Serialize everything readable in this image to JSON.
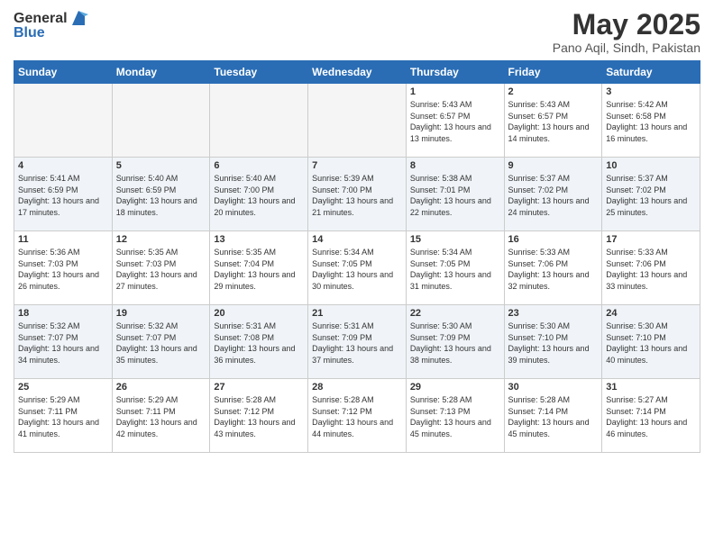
{
  "logo": {
    "general": "General",
    "blue": "Blue"
  },
  "header": {
    "title": "May 2025",
    "subtitle": "Pano Aqil, Sindh, Pakistan"
  },
  "weekdays": [
    "Sunday",
    "Monday",
    "Tuesday",
    "Wednesday",
    "Thursday",
    "Friday",
    "Saturday"
  ],
  "weeks": [
    [
      {
        "day": "",
        "info": ""
      },
      {
        "day": "",
        "info": ""
      },
      {
        "day": "",
        "info": ""
      },
      {
        "day": "",
        "info": ""
      },
      {
        "day": "1",
        "sunrise": "5:43 AM",
        "sunset": "6:57 PM",
        "daylight": "13 hours and 13 minutes."
      },
      {
        "day": "2",
        "sunrise": "5:43 AM",
        "sunset": "6:57 PM",
        "daylight": "13 hours and 14 minutes."
      },
      {
        "day": "3",
        "sunrise": "5:42 AM",
        "sunset": "6:58 PM",
        "daylight": "13 hours and 16 minutes."
      }
    ],
    [
      {
        "day": "4",
        "sunrise": "5:41 AM",
        "sunset": "6:59 PM",
        "daylight": "13 hours and 17 minutes."
      },
      {
        "day": "5",
        "sunrise": "5:40 AM",
        "sunset": "6:59 PM",
        "daylight": "13 hours and 18 minutes."
      },
      {
        "day": "6",
        "sunrise": "5:40 AM",
        "sunset": "7:00 PM",
        "daylight": "13 hours and 20 minutes."
      },
      {
        "day": "7",
        "sunrise": "5:39 AM",
        "sunset": "7:00 PM",
        "daylight": "13 hours and 21 minutes."
      },
      {
        "day": "8",
        "sunrise": "5:38 AM",
        "sunset": "7:01 PM",
        "daylight": "13 hours and 22 minutes."
      },
      {
        "day": "9",
        "sunrise": "5:37 AM",
        "sunset": "7:02 PM",
        "daylight": "13 hours and 24 minutes."
      },
      {
        "day": "10",
        "sunrise": "5:37 AM",
        "sunset": "7:02 PM",
        "daylight": "13 hours and 25 minutes."
      }
    ],
    [
      {
        "day": "11",
        "sunrise": "5:36 AM",
        "sunset": "7:03 PM",
        "daylight": "13 hours and 26 minutes."
      },
      {
        "day": "12",
        "sunrise": "5:35 AM",
        "sunset": "7:03 PM",
        "daylight": "13 hours and 27 minutes."
      },
      {
        "day": "13",
        "sunrise": "5:35 AM",
        "sunset": "7:04 PM",
        "daylight": "13 hours and 29 minutes."
      },
      {
        "day": "14",
        "sunrise": "5:34 AM",
        "sunset": "7:05 PM",
        "daylight": "13 hours and 30 minutes."
      },
      {
        "day": "15",
        "sunrise": "5:34 AM",
        "sunset": "7:05 PM",
        "daylight": "13 hours and 31 minutes."
      },
      {
        "day": "16",
        "sunrise": "5:33 AM",
        "sunset": "7:06 PM",
        "daylight": "13 hours and 32 minutes."
      },
      {
        "day": "17",
        "sunrise": "5:33 AM",
        "sunset": "7:06 PM",
        "daylight": "13 hours and 33 minutes."
      }
    ],
    [
      {
        "day": "18",
        "sunrise": "5:32 AM",
        "sunset": "7:07 PM",
        "daylight": "13 hours and 34 minutes."
      },
      {
        "day": "19",
        "sunrise": "5:32 AM",
        "sunset": "7:07 PM",
        "daylight": "13 hours and 35 minutes."
      },
      {
        "day": "20",
        "sunrise": "5:31 AM",
        "sunset": "7:08 PM",
        "daylight": "13 hours and 36 minutes."
      },
      {
        "day": "21",
        "sunrise": "5:31 AM",
        "sunset": "7:09 PM",
        "daylight": "13 hours and 37 minutes."
      },
      {
        "day": "22",
        "sunrise": "5:30 AM",
        "sunset": "7:09 PM",
        "daylight": "13 hours and 38 minutes."
      },
      {
        "day": "23",
        "sunrise": "5:30 AM",
        "sunset": "7:10 PM",
        "daylight": "13 hours and 39 minutes."
      },
      {
        "day": "24",
        "sunrise": "5:30 AM",
        "sunset": "7:10 PM",
        "daylight": "13 hours and 40 minutes."
      }
    ],
    [
      {
        "day": "25",
        "sunrise": "5:29 AM",
        "sunset": "7:11 PM",
        "daylight": "13 hours and 41 minutes."
      },
      {
        "day": "26",
        "sunrise": "5:29 AM",
        "sunset": "7:11 PM",
        "daylight": "13 hours and 42 minutes."
      },
      {
        "day": "27",
        "sunrise": "5:28 AM",
        "sunset": "7:12 PM",
        "daylight": "13 hours and 43 minutes."
      },
      {
        "day": "28",
        "sunrise": "5:28 AM",
        "sunset": "7:12 PM",
        "daylight": "13 hours and 44 minutes."
      },
      {
        "day": "29",
        "sunrise": "5:28 AM",
        "sunset": "7:13 PM",
        "daylight": "13 hours and 45 minutes."
      },
      {
        "day": "30",
        "sunrise": "5:28 AM",
        "sunset": "7:14 PM",
        "daylight": "13 hours and 45 minutes."
      },
      {
        "day": "31",
        "sunrise": "5:27 AM",
        "sunset": "7:14 PM",
        "daylight": "13 hours and 46 minutes."
      }
    ]
  ],
  "labels": {
    "sunrise": "Sunrise:",
    "sunset": "Sunset:",
    "daylight": "Daylight:"
  }
}
